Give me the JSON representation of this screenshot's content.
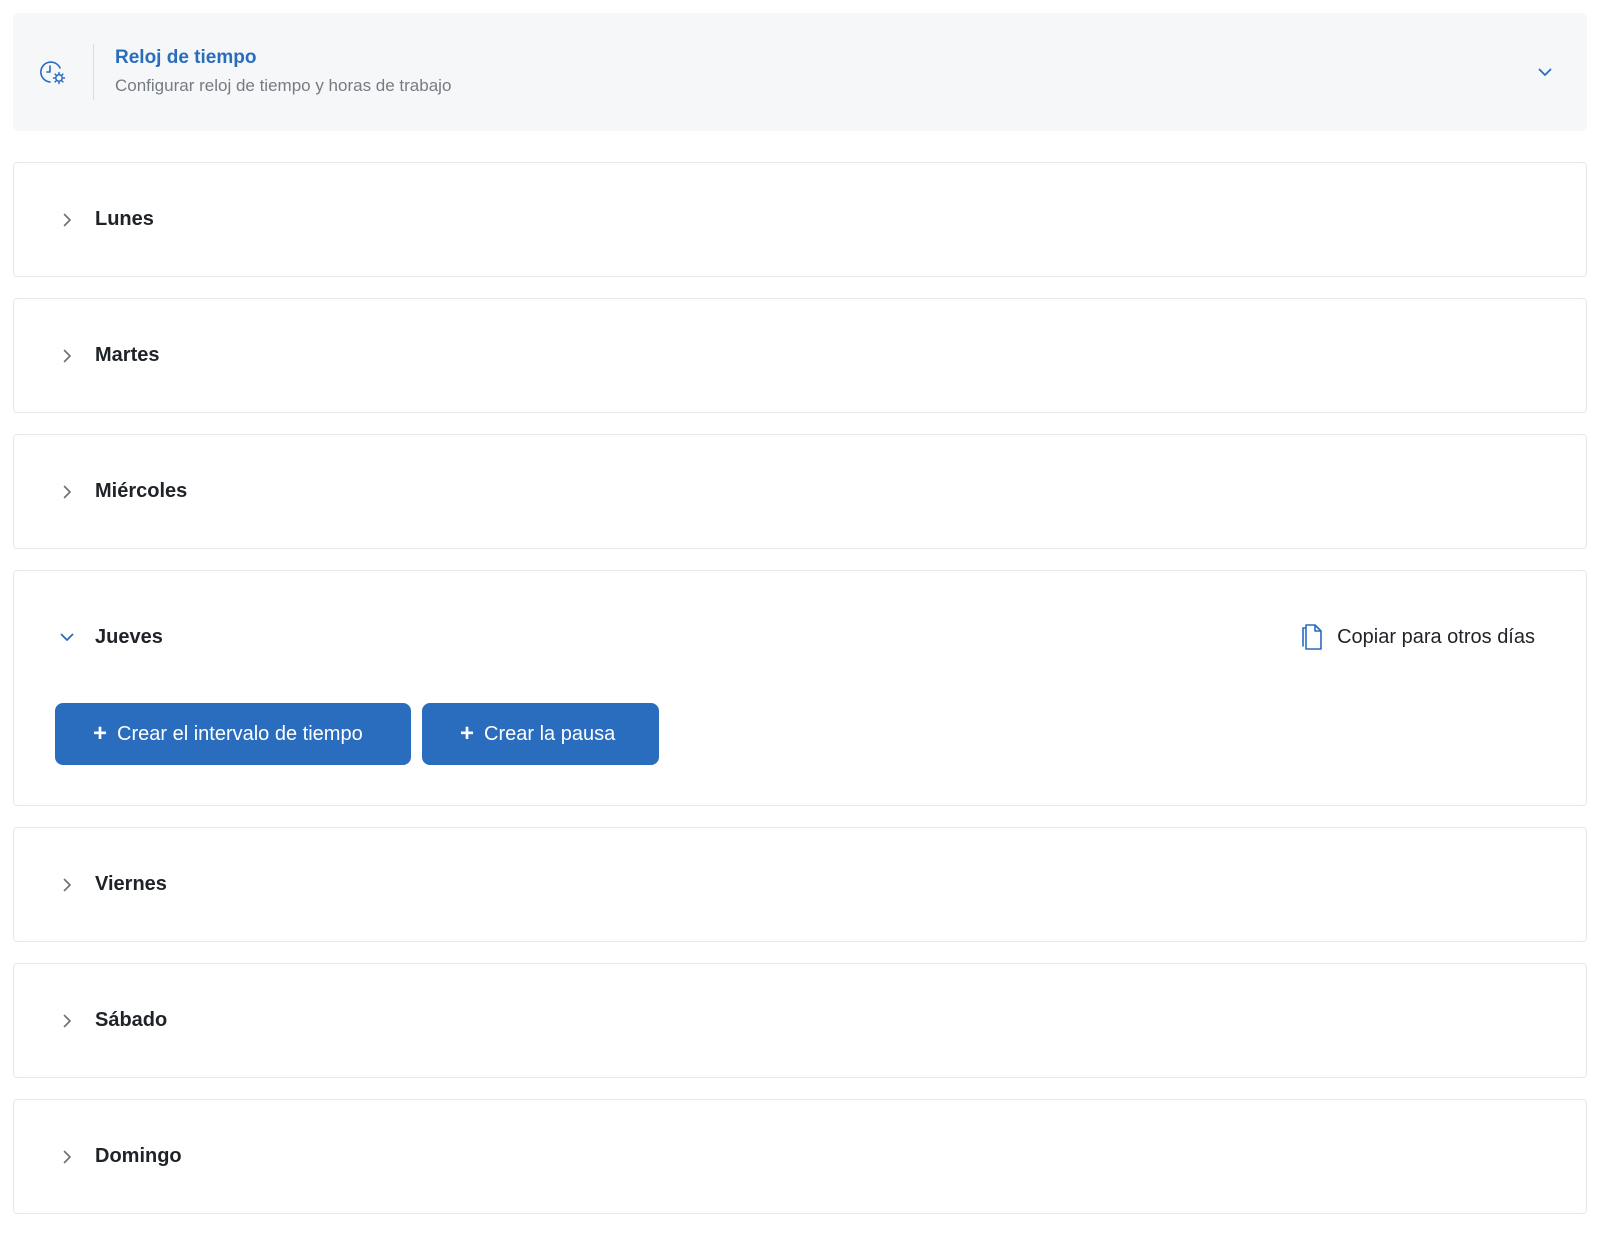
{
  "header": {
    "title": "Reloj de tiempo",
    "subtitle": "Configurar reloj de tiempo y horas de trabajo",
    "icon": "clock-settings-icon",
    "toggle_icon": "chevron-down-icon"
  },
  "days": [
    {
      "label": "Lunes",
      "expanded": false
    },
    {
      "label": "Martes",
      "expanded": false
    },
    {
      "label": "Miércoles",
      "expanded": false
    },
    {
      "label": "Jueves",
      "expanded": true
    },
    {
      "label": "Viernes",
      "expanded": false
    },
    {
      "label": "Sábado",
      "expanded": false
    },
    {
      "label": "Domingo",
      "expanded": false
    }
  ],
  "expanded_day": {
    "copy_label": "Copiar para otros días",
    "create_interval_label": "Crear el intervalo de tiempo",
    "create_pause_label": "Crear la pausa"
  },
  "colors": {
    "accent": "#2a6cbd",
    "header_bg": "#f6f7f9",
    "border": "#e6e8eb",
    "text": "#1f2328",
    "muted": "#767b82"
  }
}
